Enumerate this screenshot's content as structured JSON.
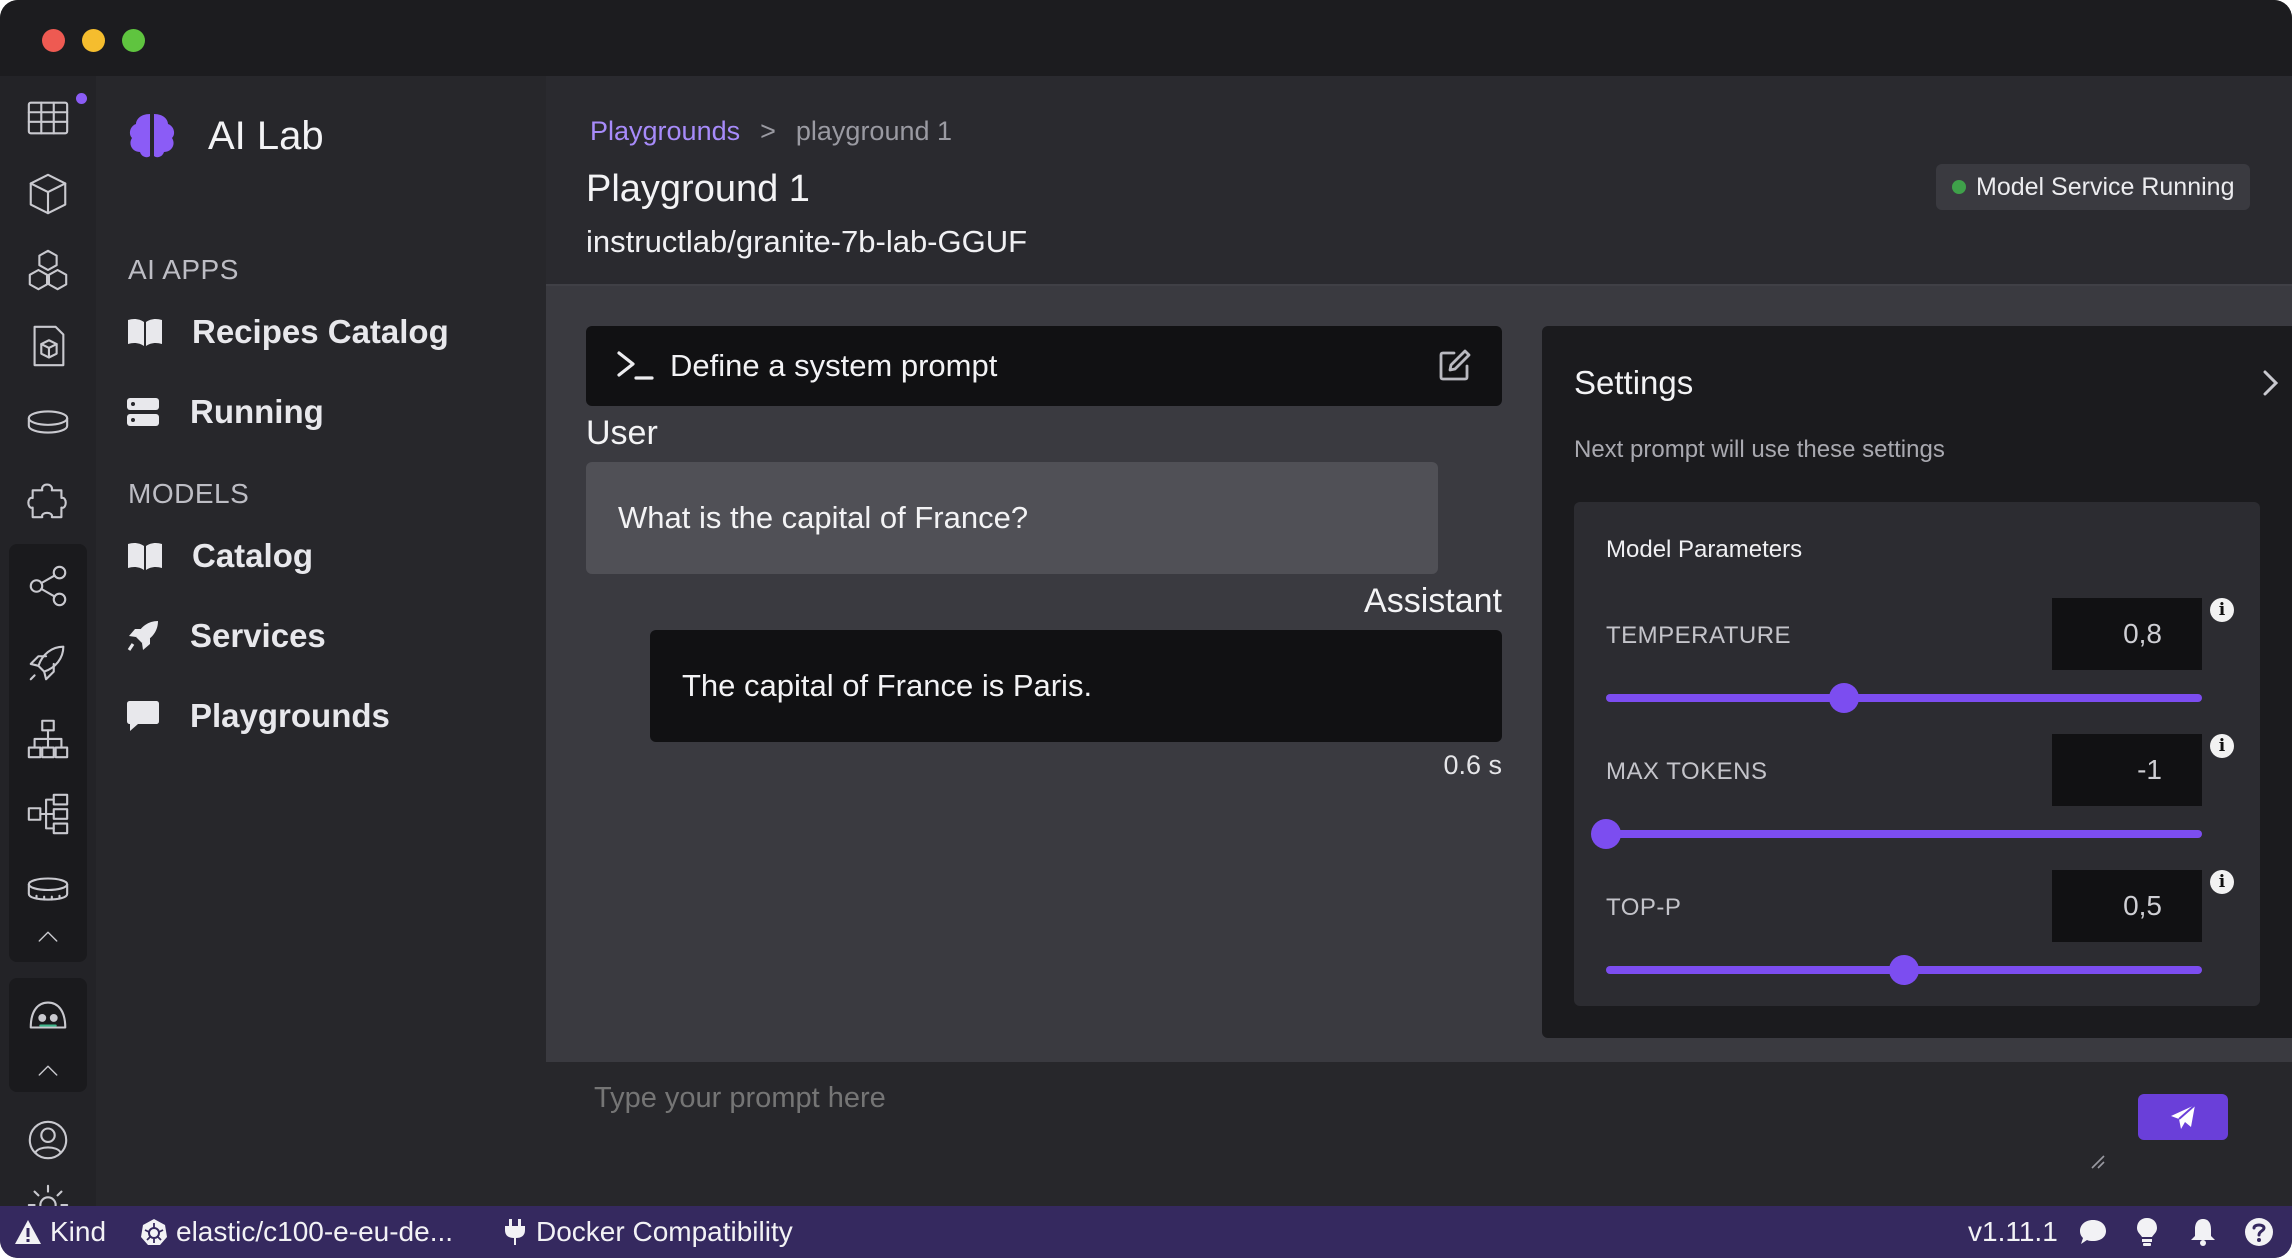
{
  "window": {
    "controls": [
      "close",
      "minimize",
      "zoom"
    ]
  },
  "icon_nav": {
    "items": [
      "dashboard-icon",
      "containers-icon",
      "pods-icon",
      "images-icon",
      "volumes-icon",
      "extensions-icon",
      "share-icon",
      "rocket-icon",
      "network-icon",
      "tree-icon",
      "storage-icon",
      "ai-lab-icon",
      "account-icon",
      "settings-icon"
    ]
  },
  "sidebar": {
    "title": "AI Lab",
    "section_apps": "AI APPS",
    "section_models": "MODELS",
    "items": [
      {
        "label": "Recipes Catalog",
        "icon": "book-icon"
      },
      {
        "label": "Running",
        "icon": "server-icon"
      },
      {
        "label": "Catalog",
        "icon": "book-icon"
      },
      {
        "label": "Services",
        "icon": "rocket-icon"
      },
      {
        "label": "Playgrounds",
        "icon": "chat-icon"
      }
    ]
  },
  "header": {
    "breadcrumb_link": "Playgrounds",
    "breadcrumb_sep": ">",
    "breadcrumb_current": "playground 1",
    "title": "Playground 1",
    "model": "instructlab/granite-7b-lab-GGUF",
    "status": "Model Service Running",
    "status_color": "#3fa14a"
  },
  "chat": {
    "system_prompt_label": "Define a system prompt",
    "user_label": "User",
    "user_message": "What is the capital of France?",
    "assistant_label": "Assistant",
    "assistant_message": "The capital of France is Paris.",
    "elapsed": "0.6 s"
  },
  "settings": {
    "title": "Settings",
    "subtitle": "Next prompt will use these settings",
    "group_title": "Model Parameters",
    "params": [
      {
        "name": "TEMPERATURE",
        "value": "0,8",
        "fraction": 0.4
      },
      {
        "name": "MAX TOKENS",
        "value": "-1",
        "fraction": 0.0
      },
      {
        "name": "TOP-P",
        "value": "0,5",
        "fraction": 0.5
      }
    ],
    "accent": "#7c4df0"
  },
  "prompt": {
    "placeholder": "Type your prompt here"
  },
  "statusbar": {
    "kind": "Kind",
    "context": "elastic/c100-e-eu-de...",
    "docker": "Docker Compatibility",
    "version": "v1.11.1"
  }
}
